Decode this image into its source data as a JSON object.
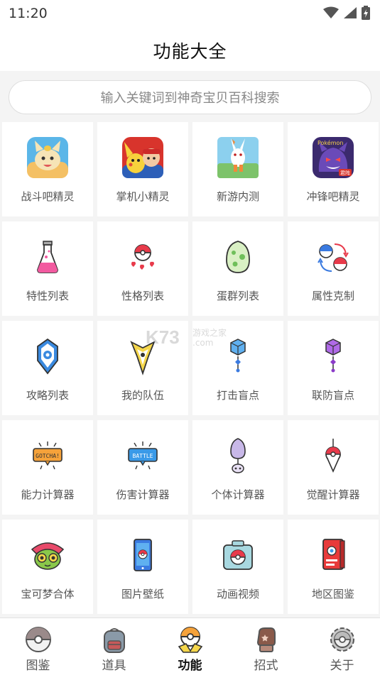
{
  "status_bar": {
    "time": "11:20",
    "icons": [
      "wifi-icon",
      "signal-icon",
      "battery-icon"
    ]
  },
  "header": {
    "title": "功能大全"
  },
  "search": {
    "placeholder": "输入关键词到神奇宝贝百科搜索"
  },
  "tiles": [
    {
      "label": "战斗吧精灵",
      "icon": "meowth-app-icon"
    },
    {
      "label": "掌机小精灵",
      "icon": "pikachu-ash-app-icon"
    },
    {
      "label": "新游内测",
      "icon": "scorbunny-app-icon"
    },
    {
      "label": "冲锋吧精灵",
      "icon": "gengar-app-icon"
    },
    {
      "label": "特性列表",
      "icon": "potion-flask-icon"
    },
    {
      "label": "性格列表",
      "icon": "pokeball-hearts-icon"
    },
    {
      "label": "蛋群列表",
      "icon": "egg-icon"
    },
    {
      "label": "属性克制",
      "icon": "type-cycle-icon"
    },
    {
      "label": "攻略列表",
      "icon": "badge-shield-icon"
    },
    {
      "label": "我的队伍",
      "icon": "team-emblem-icon"
    },
    {
      "label": "打击盲点",
      "icon": "blue-cube-icon"
    },
    {
      "label": "联防盲点",
      "icon": "purple-cube-icon"
    },
    {
      "label": "能力计算器",
      "icon": "gotcha-sign-icon"
    },
    {
      "label": "伤害计算器",
      "icon": "battle-sign-icon"
    },
    {
      "label": "个体计算器",
      "icon": "iv-egg-icon"
    },
    {
      "label": "觉醒计算器",
      "icon": "pokeball-pin-icon"
    },
    {
      "label": "宝可梦合体",
      "icon": "fusion-face-icon"
    },
    {
      "label": "图片壁纸",
      "icon": "phone-wallpaper-icon"
    },
    {
      "label": "动画视频",
      "icon": "camera-pokeball-icon"
    },
    {
      "label": "地区图鉴",
      "icon": "pokedex-book-icon"
    }
  ],
  "watermark": {
    "text": "K73",
    "subtitle": "游戏之家",
    "domain": ".com"
  },
  "tabbar": {
    "active": "功能",
    "tabs": [
      {
        "label": "图鉴",
        "icon": "pokeball-icon"
      },
      {
        "label": "道具",
        "icon": "backpack-icon"
      },
      {
        "label": "功能",
        "icon": "pokeball-wings-icon"
      },
      {
        "label": "招式",
        "icon": "boxing-glove-icon"
      },
      {
        "label": "关于",
        "icon": "gear-pokeball-icon"
      }
    ]
  },
  "colors": {
    "background": "#f4f4f4",
    "card": "#ffffff",
    "title": "#111111",
    "label": "#555555",
    "placeholder": "#888888"
  }
}
